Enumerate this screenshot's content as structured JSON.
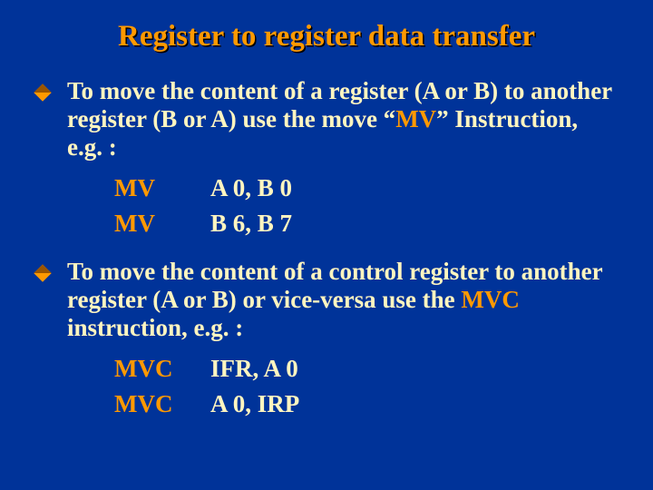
{
  "title": "Register to register data transfer",
  "bullets": [
    {
      "pre": "To move the content of a register (A or B) to another register (B or A) use the move “",
      "hl": "MV",
      "post": "” Instruction, e.g. :",
      "code": [
        {
          "mnemonic": "MV",
          "operands": "A 0, B 0"
        },
        {
          "mnemonic": "MV",
          "operands": "B 6, B 7"
        }
      ]
    },
    {
      "pre": "To move the content of a control register to another register (A or B) or vice-versa use the ",
      "hl": "MVC",
      "post": " instruction, e.g. :",
      "code": [
        {
          "mnemonic": "MVC",
          "operands": "IFR, A 0"
        },
        {
          "mnemonic": "MVC",
          "operands": "A 0, IRP"
        }
      ]
    }
  ]
}
